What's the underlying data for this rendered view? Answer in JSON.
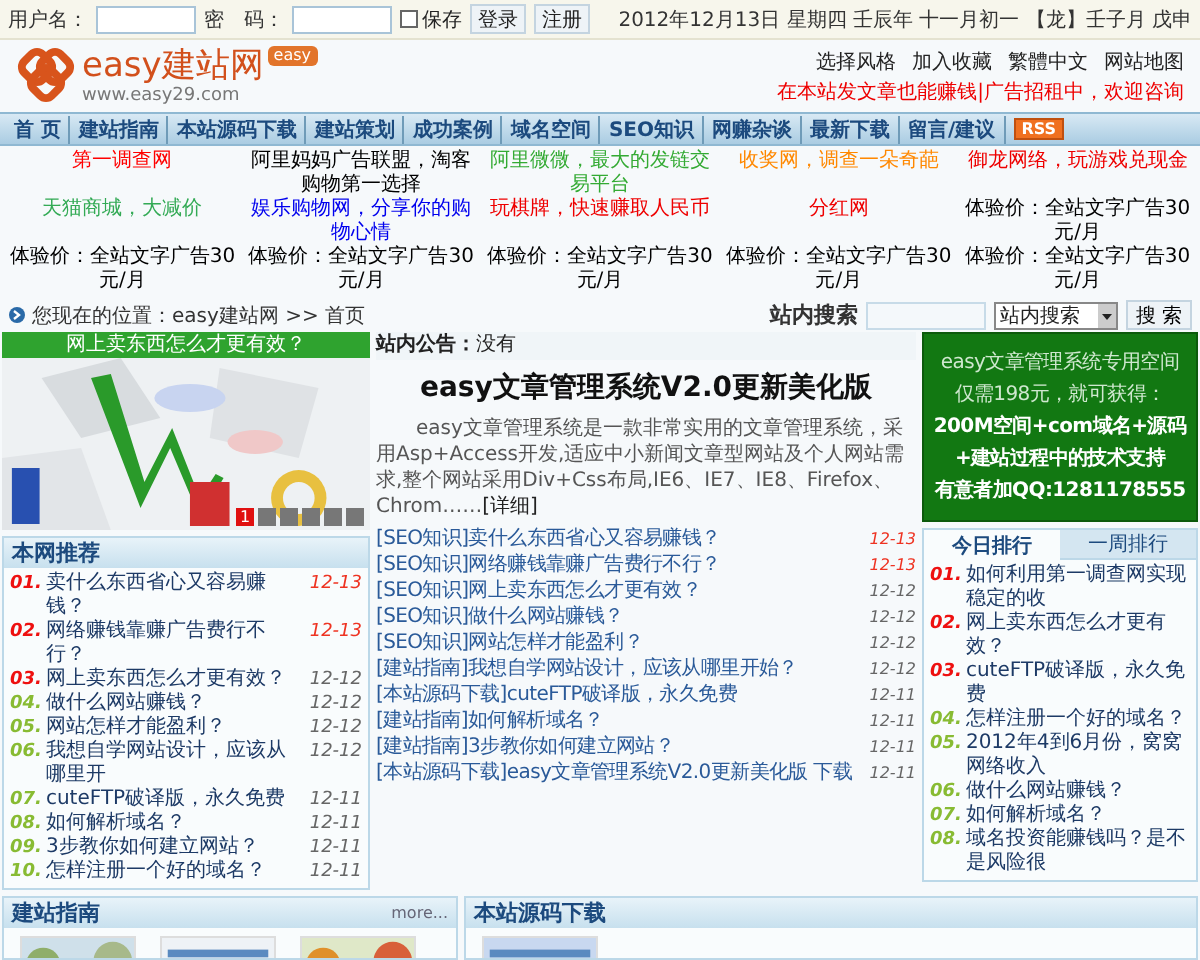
{
  "top_bar": {
    "username_label": "用户名：",
    "password_label": "密　码：",
    "remember": {
      "label": "保存",
      "checked": false
    },
    "buttons": [
      "登录",
      "注册"
    ],
    "date": "2012年12月13日 星期四 壬辰年 十一月初一 【龙】壬子月 戊申"
  },
  "header": {
    "logo_text": "easy建站网",
    "logo_badge": "easy",
    "logo_url": "www.easy29.com",
    "links": [
      "选择风格",
      "加入收藏",
      "繁體中文",
      "网站地图"
    ],
    "notice": "在本站发文章也能赚钱|广告招租中，欢迎咨询"
  },
  "nav": {
    "items": [
      {
        "label": "首 页"
      },
      {
        "label": "建站指南"
      },
      {
        "label": "本站源码下载"
      },
      {
        "label": "建站策划"
      },
      {
        "label": "成功案例"
      },
      {
        "label": "域名空间"
      },
      {
        "label": "SEO知识"
      },
      {
        "label": "网赚杂谈"
      },
      {
        "label": "最新下载"
      },
      {
        "label": "留言/建议"
      }
    ],
    "rss": "RSS"
  },
  "ads": [
    {
      "text": "第一调查网",
      "color": "#ff0000"
    },
    {
      "text": "阿里妈妈广告联盟，淘客购物第一选择",
      "color": "#000000"
    },
    {
      "text": "阿里微微，最大的发链交易平台",
      "color": "#33aa33"
    },
    {
      "text": "收奖网，调查一朵奇葩",
      "color": "#ff8800"
    },
    {
      "text": "御龙网络，玩游戏兑现金",
      "color": "#ee0000"
    },
    {
      "text": "天猫商城，大减价",
      "color": "#33aa55"
    },
    {
      "text": "娱乐购物网，分享你的购物心情",
      "color": "#0000ee"
    },
    {
      "text": "玩棋牌，快速赚取人民币",
      "color": "#ee0000"
    },
    {
      "text": "分红网",
      "color": "#ee0000"
    },
    {
      "text": "体验价：全站文字广告30元/月",
      "color": "#000000"
    },
    {
      "text": "体验价：全站文字广告30元/月",
      "color": "#000000"
    },
    {
      "text": "体验价：全站文字广告30元/月",
      "color": "#000000"
    },
    {
      "text": "体验价：全站文字广告30元/月",
      "color": "#000000"
    },
    {
      "text": "体验价：全站文字广告30元/月",
      "color": "#000000"
    },
    {
      "text": "体验价：全站文字广告30元/月",
      "color": "#000000"
    }
  ],
  "breadcrumb": "您现在的位置：easy建站网 >> 首页",
  "search": {
    "label": "站内搜索",
    "select": "站内搜索",
    "button": "搜 索"
  },
  "slideshow": {
    "title": "网上卖东西怎么才更有效？",
    "pages": [
      {
        "label": "1",
        "selected": true
      },
      {
        "selected": false
      },
      {
        "selected": false
      },
      {
        "selected": false
      },
      {
        "selected": false
      },
      {
        "selected": false
      }
    ]
  },
  "recommend": {
    "title": "本网推荐",
    "items": [
      {
        "rank": "01.",
        "title": "卖什么东西省心又容易赚钱？",
        "date": "12-13",
        "top": true,
        "hot": true
      },
      {
        "rank": "02.",
        "title": "网络赚钱靠赚广告费行不行？",
        "date": "12-13",
        "top": true,
        "hot": true
      },
      {
        "rank": "03.",
        "title": "网上卖东西怎么才更有效？",
        "date": "12-12",
        "top": true,
        "hot": false
      },
      {
        "rank": "04.",
        "title": "做什么网站赚钱？",
        "date": "12-12",
        "top": false,
        "hot": false
      },
      {
        "rank": "05.",
        "title": "网站怎样才能盈利？",
        "date": "12-12",
        "top": false,
        "hot": false
      },
      {
        "rank": "06.",
        "title": "我想自学网站设计，应该从哪里开",
        "date": "12-12",
        "top": false,
        "hot": false
      },
      {
        "rank": "07.",
        "title": "cuteFTP破译版，永久免费",
        "date": "12-11",
        "top": false,
        "hot": false
      },
      {
        "rank": "08.",
        "title": "如何解析域名？",
        "date": "12-11",
        "top": false,
        "hot": false
      },
      {
        "rank": "09.",
        "title": "3步教你如何建立网站？",
        "date": "12-11",
        "top": false,
        "hot": false
      },
      {
        "rank": "10.",
        "title": "怎样注册一个好的域名？",
        "date": "12-11",
        "top": false,
        "hot": false
      }
    ]
  },
  "announcement": {
    "label": "站内公告：",
    "text": "没有"
  },
  "headline": {
    "title": "easy文章管理系统V2.0更新美化版",
    "summary": "easy文章管理系统是一款非常实用的文章管理系统，采用Asp+Access开发,适应中小新闻文章型网站及个人网站需求,整个网站采用Div+Css布局,IE6、IE7、IE8、Firefox、Chrom……",
    "more": "[详细]"
  },
  "articles": [
    {
      "title": "[SEO知识]卖什么东西省心又容易赚钱？",
      "date": "12-13",
      "hot": true
    },
    {
      "title": "[SEO知识]网络赚钱靠赚广告费行不行？",
      "date": "12-13",
      "hot": true
    },
    {
      "title": "[SEO知识]网上卖东西怎么才更有效？",
      "date": "12-12",
      "hot": false
    },
    {
      "title": "[SEO知识]做什么网站赚钱？",
      "date": "12-12",
      "hot": false
    },
    {
      "title": "[SEO知识]网站怎样才能盈利？",
      "date": "12-12",
      "hot": false
    },
    {
      "title": "[建站指南]我想自学网站设计，应该从哪里开始？",
      "date": "12-12",
      "hot": false
    },
    {
      "title": "[本站源码下载]cuteFTP破译版，永久免费",
      "date": "12-11",
      "hot": false
    },
    {
      "title": "[建站指南]如何解析域名？",
      "date": "12-11",
      "hot": false
    },
    {
      "title": "[建站指南]3步教你如何建立网站？",
      "date": "12-11",
      "hot": false
    },
    {
      "title": "[本站源码下载]easy文章管理系统V2.0更新美化版 下载",
      "date": "12-11",
      "hot": false
    }
  ],
  "promo": {
    "lines": [
      {
        "text": "easy文章管理系统专用空间",
        "kind": "plain"
      },
      {
        "text": "仅需198元，就可获得：",
        "kind": "plain"
      },
      {
        "text": "200M空间+com域名+源码",
        "kind": "strong"
      },
      {
        "text": "+建站过程中的技术支持",
        "kind": "note"
      },
      {
        "text": "有意者加QQ:1281178555",
        "kind": "strong"
      }
    ]
  },
  "ranking": {
    "tabs": [
      {
        "label": "今日排行",
        "selected": true
      },
      {
        "label": "一周排行",
        "selected": false
      }
    ],
    "items": [
      {
        "rank": "01.",
        "title": "如何利用第一调查网实现稳定的收",
        "top": true
      },
      {
        "rank": "02.",
        "title": "网上卖东西怎么才更有效？",
        "top": true
      },
      {
        "rank": "03.",
        "title": "cuteFTP破译版，永久免费",
        "top": true
      },
      {
        "rank": "04.",
        "title": "怎样注册一个好的域名？",
        "top": false
      },
      {
        "rank": "05.",
        "title": "2012年4到6月份，窝窝网络收入",
        "top": false
      },
      {
        "rank": "06.",
        "title": "做什么网站赚钱？",
        "top": false
      },
      {
        "rank": "07.",
        "title": "如何解析域名？",
        "top": false
      },
      {
        "rank": "08.",
        "title": "域名投资能赚钱吗？是不是风险很",
        "top": false
      }
    ]
  },
  "bottom": {
    "guide": {
      "title": "建站指南",
      "more": "more..."
    },
    "source": {
      "title": "本站源码下载"
    }
  }
}
